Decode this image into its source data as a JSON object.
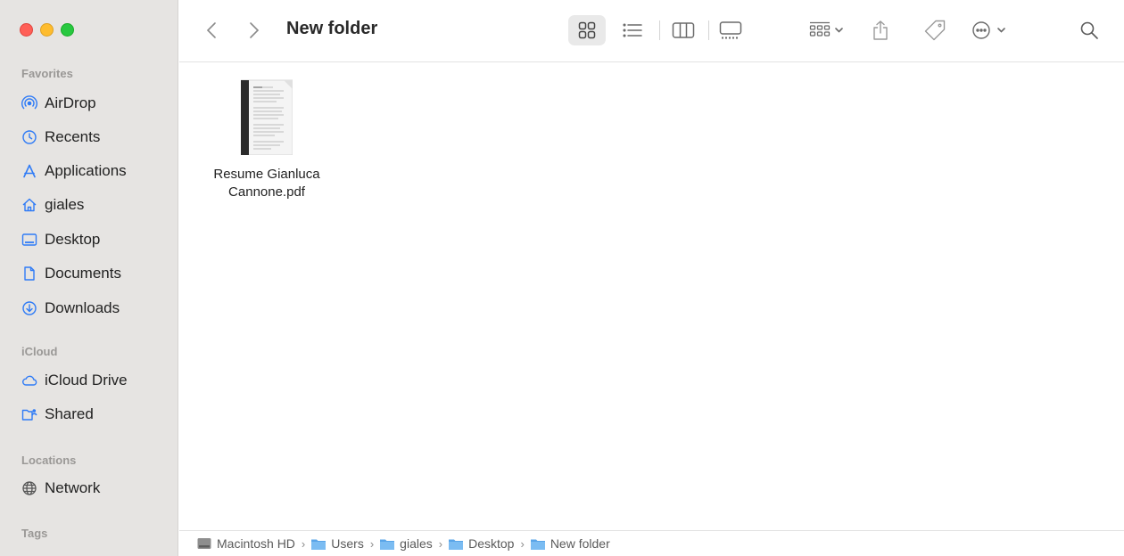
{
  "window": {
    "title": "New folder"
  },
  "sidebar": {
    "sections": {
      "favorites": "Favorites",
      "icloud": "iCloud",
      "locations": "Locations",
      "tags": "Tags"
    },
    "favorites": [
      {
        "label": "AirDrop",
        "icon": "airdrop-icon"
      },
      {
        "label": "Recents",
        "icon": "clock-icon"
      },
      {
        "label": "Applications",
        "icon": "applications-icon"
      },
      {
        "label": "giales",
        "icon": "home-icon"
      },
      {
        "label": "Desktop",
        "icon": "desktop-icon"
      },
      {
        "label": "Documents",
        "icon": "document-icon"
      },
      {
        "label": "Downloads",
        "icon": "download-icon"
      }
    ],
    "icloud": [
      {
        "label": "iCloud Drive",
        "icon": "cloud-icon"
      },
      {
        "label": "Shared",
        "icon": "shared-folder-icon"
      }
    ],
    "locations": [
      {
        "label": "Network",
        "icon": "globe-icon"
      }
    ]
  },
  "toolbar": {
    "view_mode": "icons",
    "buttons": [
      "back",
      "forward",
      "icon-view",
      "list-view",
      "column-view",
      "gallery-view",
      "group",
      "share",
      "tags",
      "more",
      "search"
    ]
  },
  "content": {
    "files": [
      {
        "name": "Resume Gianluca Cannone.pdf",
        "type": "pdf"
      }
    ]
  },
  "pathbar": {
    "items": [
      {
        "label": "Macintosh HD",
        "icon": "hard-drive-icon"
      },
      {
        "label": "Users",
        "icon": "folder-icon"
      },
      {
        "label": "giales",
        "icon": "folder-icon"
      },
      {
        "label": "Desktop",
        "icon": "folder-icon"
      },
      {
        "label": "New folder",
        "icon": "folder-icon"
      }
    ]
  },
  "colors": {
    "accent": "#2f7bf6",
    "sidebar_bg": "#e6e4e2",
    "close": "#ff5f57",
    "minimize": "#febc2e",
    "zoom": "#28c840"
  }
}
